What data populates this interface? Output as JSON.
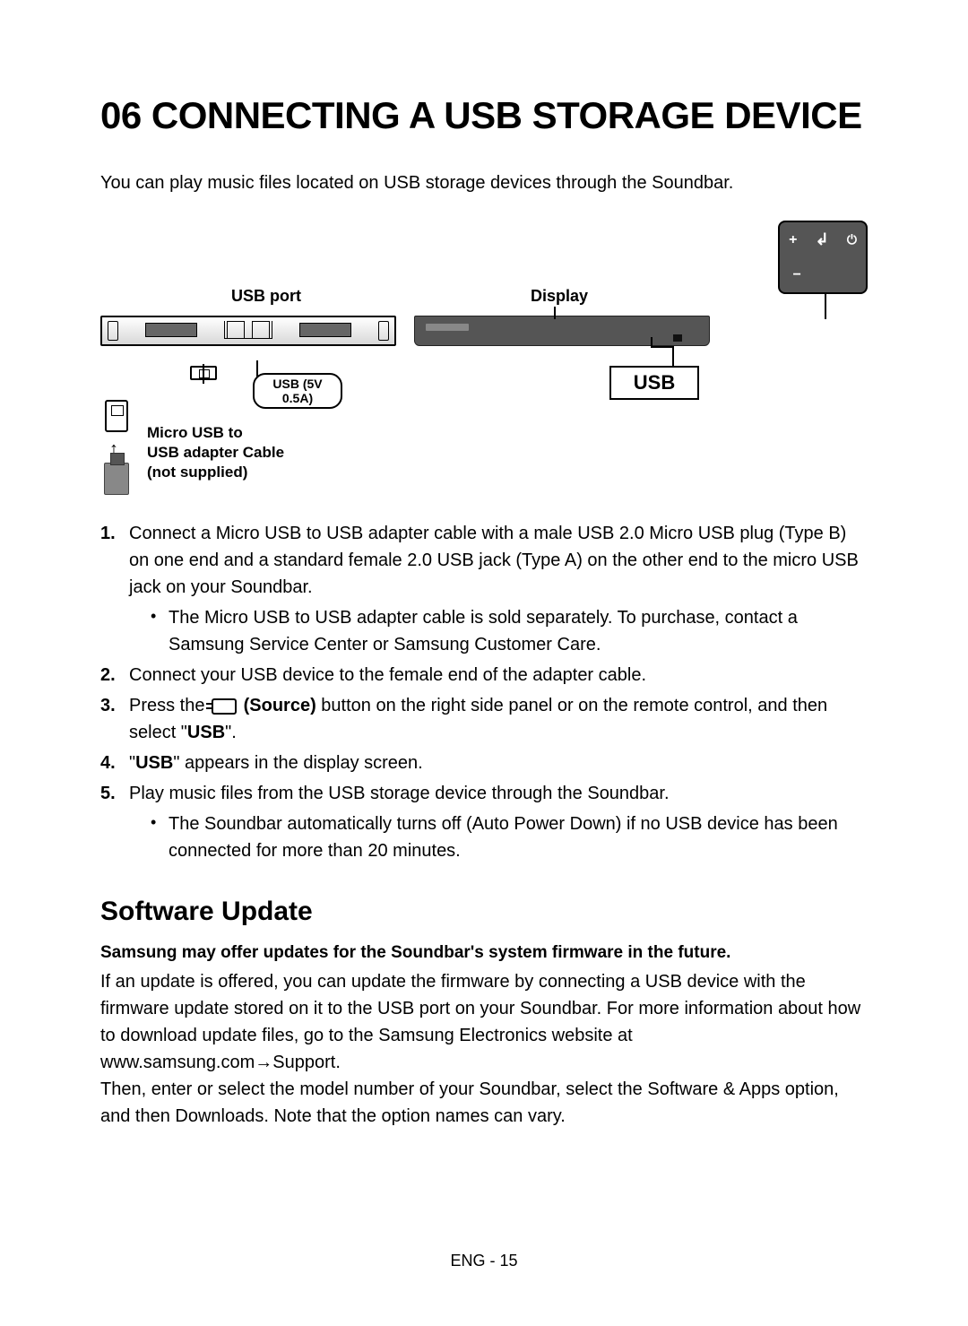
{
  "title": "06 CONNECTING A USB STORAGE DEVICE",
  "intro": "You can play music files located on USB storage devices through the Soundbar.",
  "labels": {
    "usb_port": "USB port",
    "display": "Display",
    "usb_5v": "USB (5V 0.5A)",
    "micro_usb_line1": "Micro USB to",
    "micro_usb_line2": "USB adapter Cable",
    "micro_usb_line3": "(not supplied)",
    "usb_display": "USB",
    "control_plus": "+",
    "control_minus": "−",
    "control_source": "↲",
    "control_power": "⏻"
  },
  "steps": {
    "s1": "Connect a Micro USB to USB adapter cable with a male USB 2.0 Micro USB plug (Type B) on one end and a standard female 2.0 USB jack (Type A) on the other end to the micro USB jack on your Soundbar.",
    "s1_sub": "The Micro USB to USB adapter cable is sold separately. To purchase, contact a Samsung Service Center or Samsung Customer Care.",
    "s2": "Connect your USB device to the female end of the adapter cable.",
    "s3_pre": "Press the ",
    "s3_source": " (Source)",
    "s3_post": " button on the right side panel or on the remote control, and then select \"",
    "s3_usb": "USB",
    "s3_end": "\".",
    "s4_pre": "\"",
    "s4_usb": "USB",
    "s4_post": "\" appears in the display screen.",
    "s5": "Play music files from the USB storage device through the Soundbar.",
    "s5_sub": "The Soundbar automatically turns off (Auto Power Down) if no USB device has been connected for more than 20 minutes."
  },
  "subheading": "Software Update",
  "sub_bold": "Samsung may offer updates for the Soundbar's system firmware in the future.",
  "para1": "If an update is offered, you can update the firmware by connecting a USB device with the firmware update stored on it to the USB port on your Soundbar. For more information about how to download update files, go to the Samsung Electronics website at www.samsung.com→Support.",
  "para2": "Then, enter or select the model number of your Soundbar, select the Software & Apps option, and then Downloads. Note that the option names can vary.",
  "footer": "ENG - 15"
}
